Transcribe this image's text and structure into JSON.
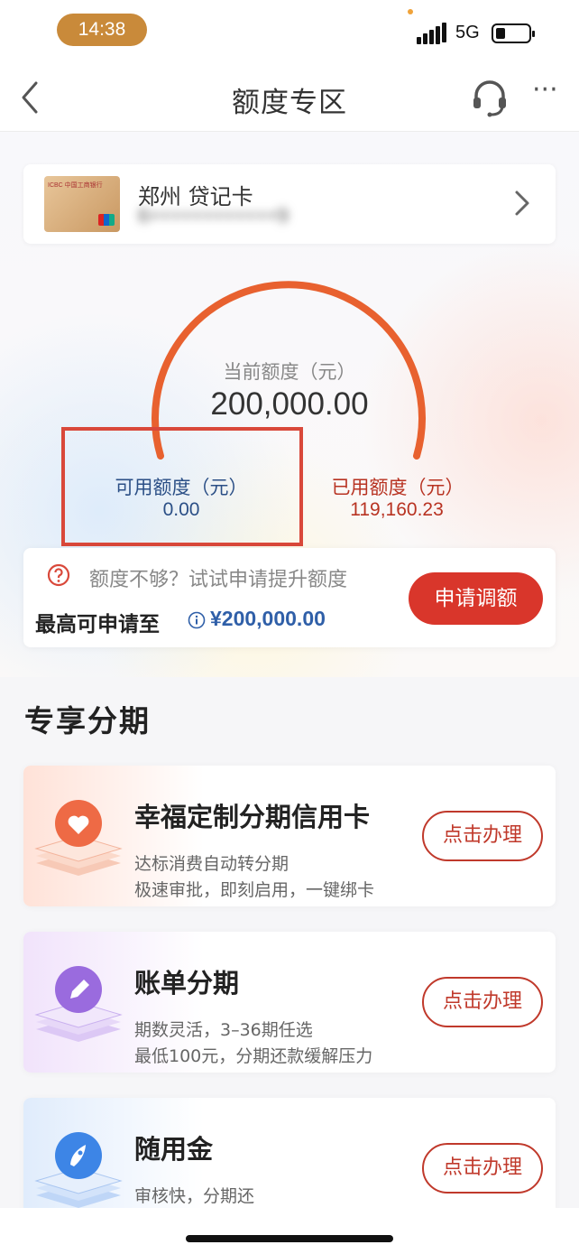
{
  "status_bar": {
    "time": "14:38",
    "network": "5G",
    "icons": [
      "signal-icon",
      "battery-icon"
    ]
  },
  "nav": {
    "title": "额度专区",
    "back_icon": "chevron-left-icon",
    "support_icon": "headset-icon",
    "more_icon": "more-dots-icon",
    "more_glyph": "···"
  },
  "card": {
    "name": "郑州 贷记卡",
    "number_masked": "6••••••••••••9",
    "bank_logo_text": "ICBC 中国工商银行"
  },
  "quota": {
    "total_label": "当前额度（元）",
    "total_value": "200,000.00",
    "available_label": "可用额度（元）",
    "available_value": "0.00",
    "used_label": "已用额度（元）",
    "used_value": "119,160.23",
    "colors": {
      "arc": "#e8612f",
      "available": "#2b4f86",
      "used": "#b83322",
      "highlight": "#d9483a"
    }
  },
  "increase": {
    "hint": "额度不够？试试申请提升额度",
    "max_label": "最高可申请至",
    "max_value": "¥200,000.00",
    "button": "申请调额"
  },
  "section": {
    "title": "专享分期"
  },
  "products": [
    {
      "title": "幸福定制分期信用卡",
      "line1": "达标消费自动转分期",
      "line2": "极速审批，即刻启用，一键绑卡",
      "button": "点击办理",
      "icon": "heart-icon"
    },
    {
      "title": "账单分期",
      "line1": "期数灵活，3–36期任选",
      "line2": "最低100元，分期还款缓解压力",
      "button": "点击办理",
      "icon": "pencil-icon"
    },
    {
      "title": "随用金",
      "line1": "审核快，分期还",
      "line2": "",
      "button": "点击办理",
      "icon": "rocket-icon"
    }
  ]
}
